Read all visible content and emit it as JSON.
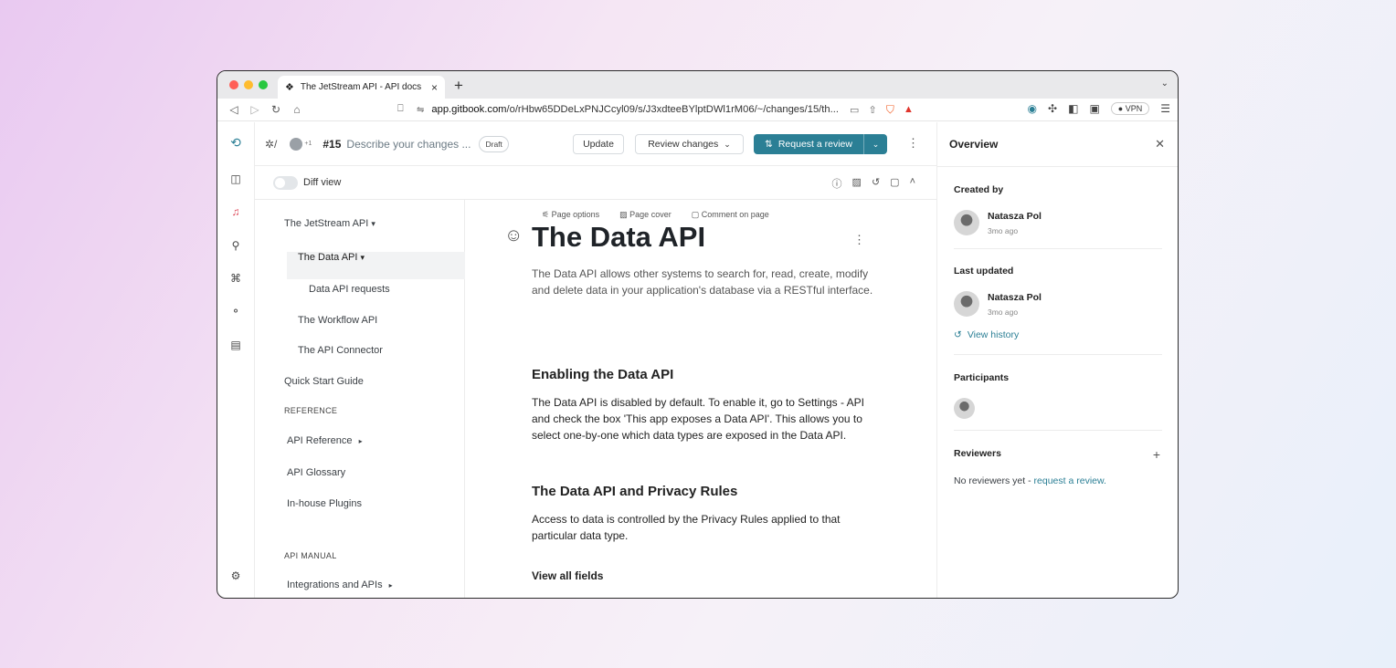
{
  "browser": {
    "tab_title": "The JetStream API - API docs",
    "url_host": "app.gitbook.com",
    "url_path": "/o/rHbw65DDeLxPNJCcyl09/s/J3xdteeBYlptDWl1rM06/~/changes/15/th...",
    "vpn_label": "VPN",
    "traffic_colors": [
      "#ff5f57",
      "#febc2e",
      "#28c840"
    ]
  },
  "header": {
    "change_number": "#15",
    "change_title": "Describe your changes ...",
    "status_badge": "Draft",
    "avatar_count": "+1",
    "update_label": "Update",
    "review_changes_label": "Review changes",
    "request_review_label": "Request a review",
    "accent_color": "#2b7f95"
  },
  "subheader": {
    "diff_view_label": "Diff view"
  },
  "toc": {
    "items": [
      {
        "label": "The JetStream API",
        "caret": "▾"
      },
      {
        "label": "The Data API",
        "caret": "▾"
      },
      {
        "label": "Data API requests"
      },
      {
        "label": "The Workflow API"
      },
      {
        "label": "The API Connector"
      },
      {
        "label": "Quick Start Guide"
      },
      {
        "label": "REFERENCE"
      },
      {
        "label": "API Reference",
        "caret": "▸"
      },
      {
        "label": "API Glossary"
      },
      {
        "label": "In-house Plugins"
      },
      {
        "label": "API MANUAL"
      },
      {
        "label": "Integrations and APIs",
        "caret": "▸"
      }
    ]
  },
  "content": {
    "page_options": "Page options",
    "page_cover": "Page cover",
    "comment_on_page": "Comment on page",
    "title": "The Data API",
    "intro": "The Data API allows other systems to search for, read, create, modify and delete data in your application's database via a RESTful interface.",
    "section1_heading": "Enabling the Data API",
    "section1_text": "The Data API is disabled by default. To enable it, go to Settings - API and check the box 'This app exposes a Data API'. This allows you to select one-by-one which data types are exposed in the Data API.",
    "section2_heading": "The Data API and Privacy Rules",
    "section2_text": "Access to data is controlled by the Privacy Rules applied to that particular data type.",
    "section3_heading": "View all fields"
  },
  "panel": {
    "title": "Overview",
    "created_by_label": "Created by",
    "created_by_name": "Natasza Pol",
    "created_time": "3mo ago",
    "last_updated_label": "Last updated",
    "updated_by_name": "Natasza Pol",
    "updated_time": "3mo ago",
    "view_history_label": "View history",
    "participants_label": "Participants",
    "reviewers_label": "Reviewers",
    "no_reviewers_text": "No reviewers yet - ",
    "request_review_link": "request a review."
  }
}
